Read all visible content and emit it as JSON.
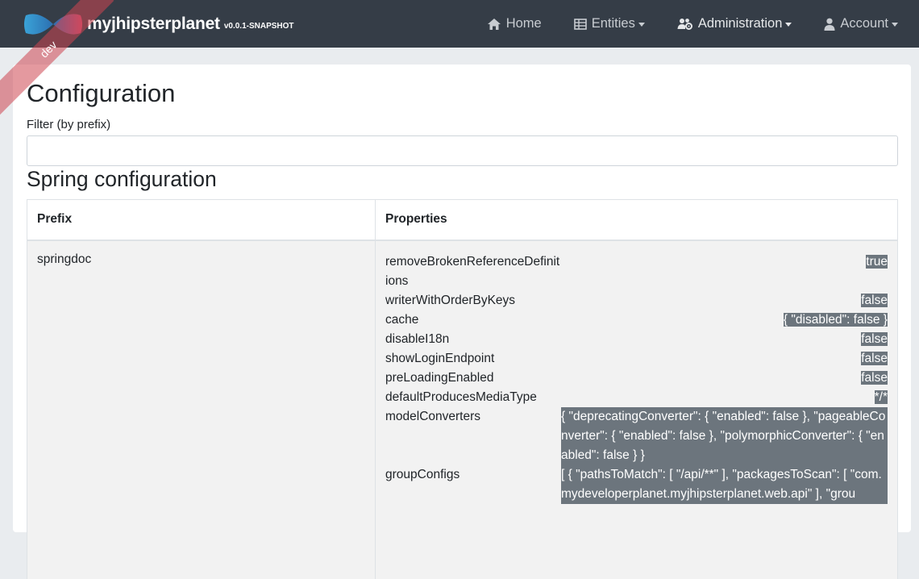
{
  "navbar": {
    "brand": "myjhipsterplanet",
    "version": "v0.0.1-SNAPSHOT",
    "ribbon": "dev",
    "items": [
      {
        "label": "Home",
        "icon": "home-icon"
      },
      {
        "label": "Entities",
        "icon": "table-icon"
      },
      {
        "label": "Administration",
        "icon": "users-cog-icon"
      },
      {
        "label": "Account",
        "icon": "user-icon"
      }
    ]
  },
  "page": {
    "title": "Configuration",
    "filter_label": "Filter (by prefix)",
    "filter_value": "",
    "section_title": "Spring configuration"
  },
  "table": {
    "headers": [
      "Prefix",
      "Properties"
    ],
    "rows": [
      {
        "prefix": "springdoc",
        "properties": [
          {
            "key": "removeBrokenReferenceDefinitions",
            "value": "true"
          },
          {
            "key": "writerWithOrderByKeys",
            "value": "false"
          },
          {
            "key": "cache",
            "value": "{ \"disabled\": false }"
          },
          {
            "key": "disableI18n",
            "value": "false"
          },
          {
            "key": "showLoginEndpoint",
            "value": "false"
          },
          {
            "key": "preLoadingEnabled",
            "value": "false"
          },
          {
            "key": "defaultProducesMediaType",
            "value": "*/*"
          },
          {
            "key": "modelConverters",
            "value": "{ \"deprecatingConverter\": { \"enabled\": false }, \"pageableConverter\": { \"enabled\": false }, \"polymorphicConverter\": { \"enabled\": false } }"
          },
          {
            "key": "groupConfigs",
            "value": "[ { \"pathsToMatch\": [ \"/api/**\" ], \"packagesToScan\": [ \"com.mydeveloperplanet.myjhipsterplanet.web.api\" ], \"grou"
          }
        ]
      }
    ]
  },
  "colors": {
    "navbar": "#353d47",
    "badge": "#6c757d",
    "ribbon": "#ce4650",
    "row_bg": "#f2f2f2"
  }
}
